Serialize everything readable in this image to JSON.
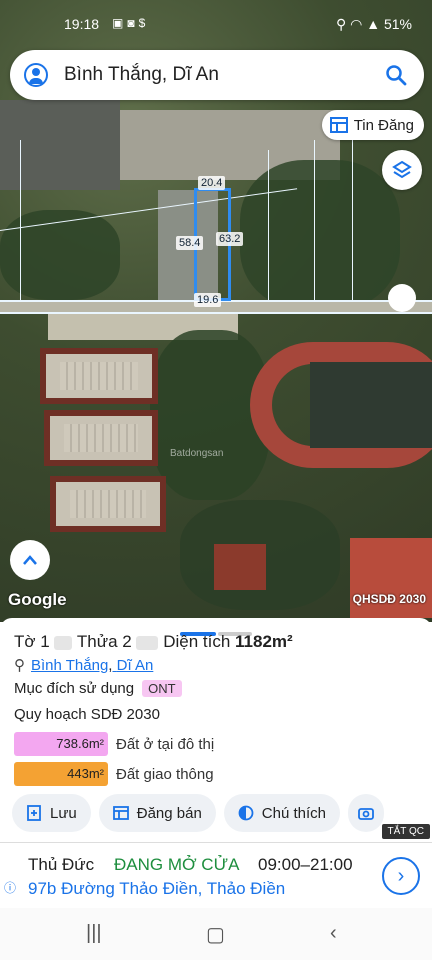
{
  "status_bar": {
    "time": "19:18",
    "battery": "51%"
  },
  "search": {
    "query": "Bình Thắng, Dĩ An"
  },
  "map": {
    "tin_dang_label": "Tin Đăng",
    "dims": {
      "top": "20.4",
      "left": "58.4",
      "right": "63.2",
      "bottom": "19.6"
    },
    "google_label": "Google",
    "layer_label": "QHSDĐ 2030",
    "watermark": "Batdongsan"
  },
  "sheet": {
    "title_prefix": "Tờ 1",
    "title_mid": "Thửa 2",
    "title_dt": "Diện tích",
    "area": "1182m²",
    "ward": "Bình Thắng",
    "sep": ",",
    "city": "Dĩ An",
    "purpose_label": "Mục đích sử dụng",
    "purpose_badge": "ONT",
    "plan_label": "Quy hoạch SDĐ 2030",
    "zones": [
      {
        "value": "738.6m²",
        "label": "Đất ở tại đô thị",
        "color": "#f3a7f0"
      },
      {
        "value": "443m²",
        "label": "Đất giao thông",
        "color": "#f4a233"
      }
    ],
    "actions": [
      {
        "label": "Lưu"
      },
      {
        "label": "Đăng bán"
      },
      {
        "label": "Chú thích"
      }
    ],
    "ad_badge": "TẮT QC"
  },
  "ad": {
    "shop": "Thủ Đức",
    "status": "ĐANG MỞ CỬA",
    "hours": "09:00–21:00",
    "address": "97b Đường Thảo Điền, Thảo Điền"
  }
}
